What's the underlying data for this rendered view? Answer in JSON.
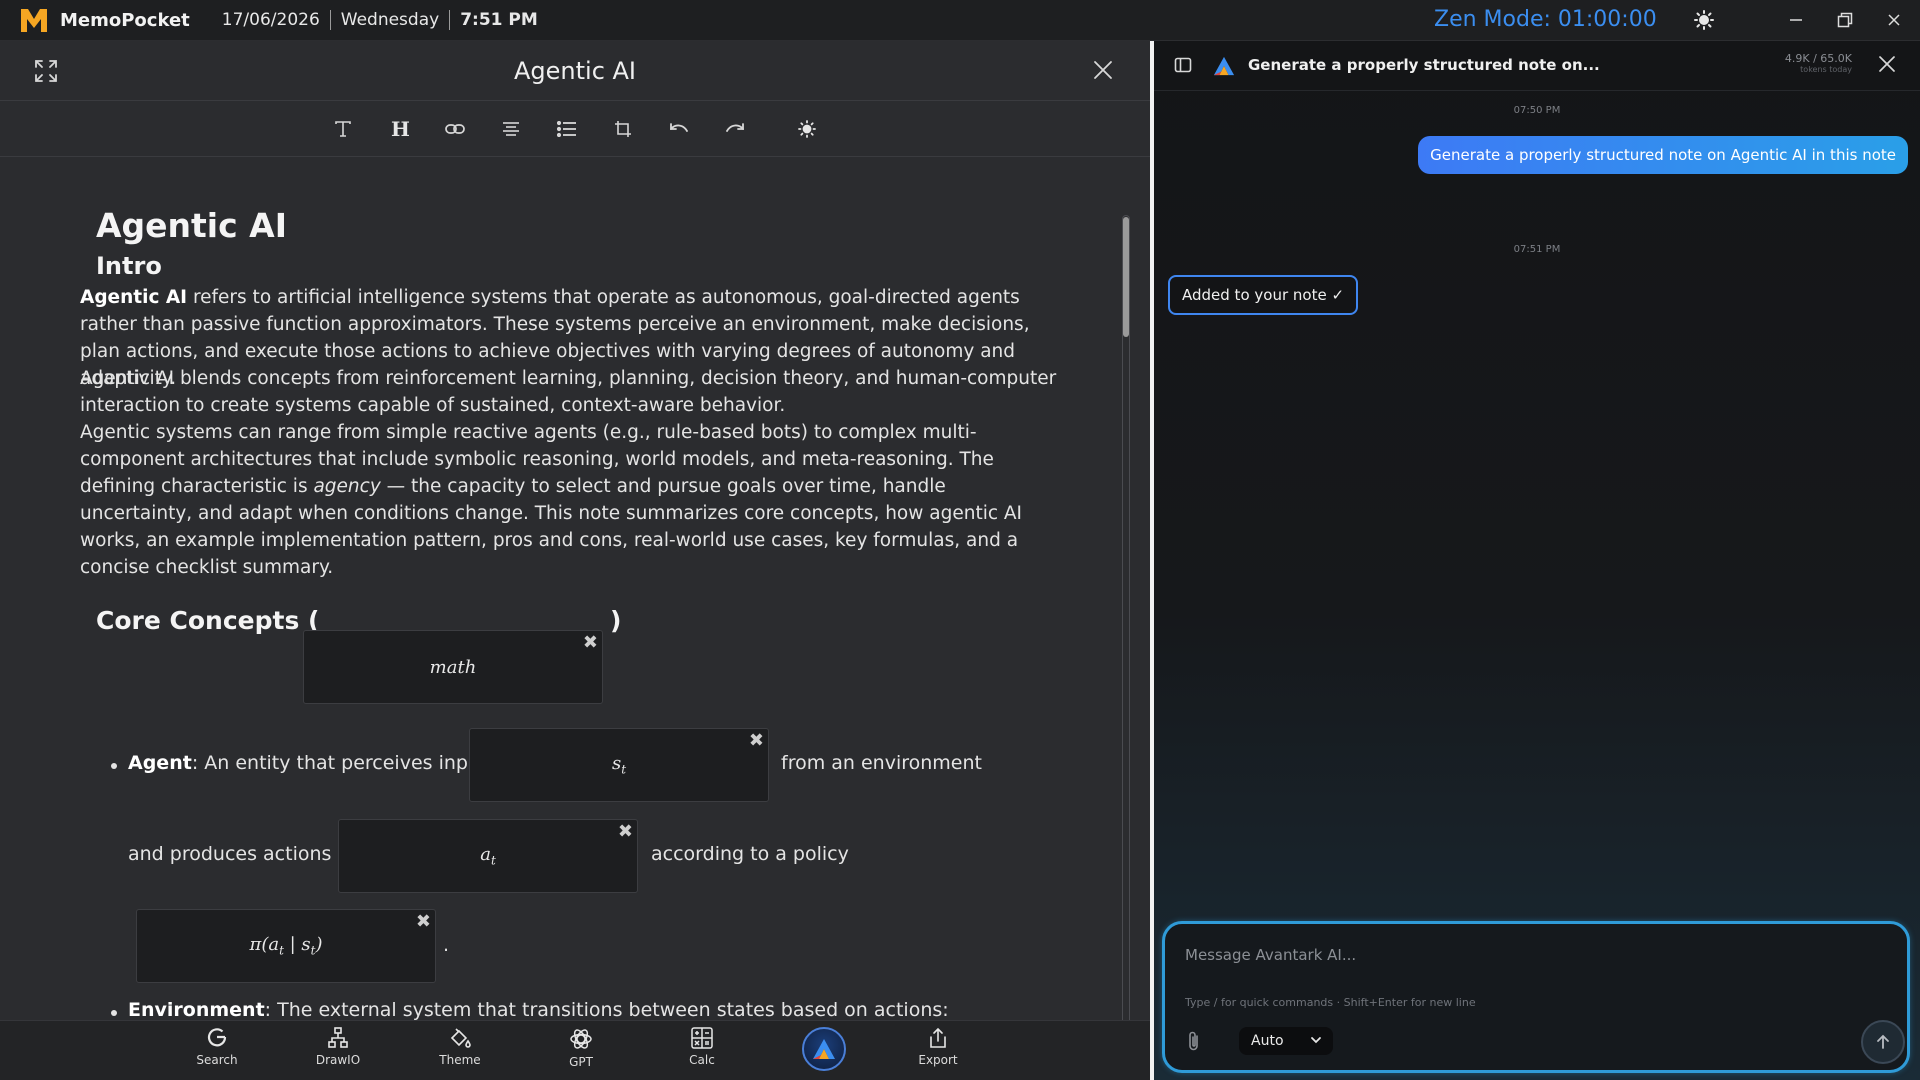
{
  "topbar": {
    "app_name": "MemoPocket",
    "date": "17/06/2026",
    "weekday": "Wednesday",
    "time": "7:51 PM",
    "zen_mode": "Zen Mode: 01:00:00"
  },
  "editor": {
    "title": "Agentic AI",
    "h1": "Agentic AI",
    "h2": "Intro",
    "intro_bold": "Agentic AI",
    "intro_rest": " refers to artificial intelligence systems that operate as autonomous, goal-directed agents rather than passive function approximators. These systems perceive an environment, make decisions, plan actions, and execute those actions to achieve objectives with varying degrees of autonomy and adaptivity.",
    "para2": "Agentic AI blends concepts from reinforcement learning, planning, decision theory, and human-computer interaction to create systems capable of sustained, context-aware behavior.",
    "para3_a": "Agentic systems can range from simple reactive agents (e.g., rule-based bots) to complex multi-component architectures that include symbolic reasoning, world models, and meta-reasoning. The defining characteristic is ",
    "para3_em": "agency",
    "para3_b": " — the capacity to select and pursue goals over time, handle uncertainty, and adapt when conditions change. This note summarizes core concepts, how agentic AI works, an example implementation pattern, pros and cons, real-world use cases, key formulas, and a concise checklist summary.",
    "core_title_open": "Core Concepts (",
    "core_title_close": ")",
    "math_core": "math",
    "agent_label": "Agent",
    "agent_text1": ": An entity that perceives input",
    "math_st": "s",
    "math_st_sub": "t",
    "agent_text2": "from an environment",
    "agent_text3": "and produces actions",
    "math_at": "a",
    "math_at_sub": "t",
    "agent_text4": "according to a policy",
    "math_policy": "π(a",
    "math_policy_sub": "t",
    "math_policy_mid": " | s",
    "math_policy_sub2": "t",
    "math_policy_end": ")",
    "agent_text5": ".",
    "env_label": "Environment",
    "env_text": ": The external system that transitions between states based on actions:",
    "remove_glyph": "✖"
  },
  "dock": {
    "items": [
      {
        "label": "Search",
        "icon": "google-icon"
      },
      {
        "label": "DrawIO",
        "icon": "drawio-icon"
      },
      {
        "label": "Theme",
        "icon": "paint-bucket-icon"
      },
      {
        "label": "GPT",
        "icon": "openai-icon"
      },
      {
        "label": "Calc",
        "icon": "calculator-icon"
      },
      {
        "label": "Export",
        "icon": "share-icon"
      }
    ]
  },
  "chat": {
    "title": "Generate a properly structured note on...",
    "tokens_main": "4.9K / 65.0K",
    "tokens_sub": "tokens today",
    "ts1": "07:50 PM",
    "user_message": "Generate a properly structured note on Agentic AI in this note",
    "ts2": "07:51 PM",
    "bot_message": "Added to your note ✓",
    "placeholder": "Message Avantark AI...",
    "hint": "Type / for quick commands · Shift+Enter for new line",
    "model": "Auto"
  },
  "colors": {
    "accent_blue": "#3b8ef0",
    "logo_orange": "#f5a623",
    "composer_border": "#2f9bd8"
  }
}
